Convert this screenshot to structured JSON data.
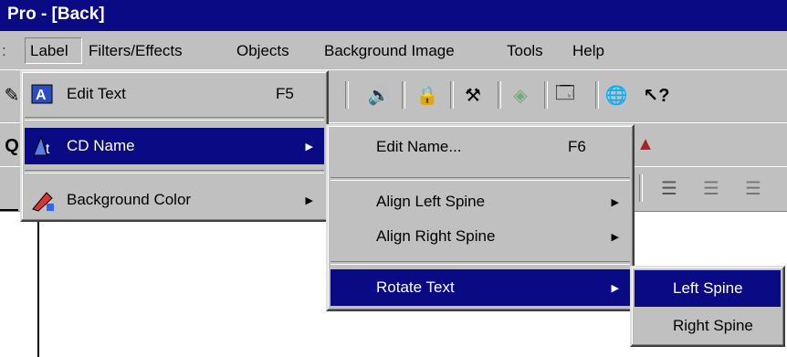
{
  "window": {
    "title": "Pro - [Back]"
  },
  "menubar": {
    "items": [
      {
        "label": "Label"
      },
      {
        "label": "Filters/Effects"
      },
      {
        "label": "Objects"
      },
      {
        "label": "Background Image"
      },
      {
        "label": "Tools"
      },
      {
        "label": "Help"
      }
    ]
  },
  "label_menu": {
    "items": [
      {
        "label": "Edit Text",
        "shortcut": "F5",
        "icon": "edit-text-icon"
      },
      {
        "label": "CD Name",
        "icon": "cd-name-icon",
        "submenu": true
      },
      {
        "label": "Background Color",
        "icon": "paint-bucket-icon",
        "submenu": true
      }
    ]
  },
  "cdname_menu": {
    "items": [
      {
        "label": "Edit Name...",
        "shortcut": "F6"
      },
      {
        "label": "Align Left Spine",
        "submenu": true
      },
      {
        "label": "Align Right Spine",
        "submenu": true
      },
      {
        "label": "Rotate Text",
        "submenu": true
      }
    ]
  },
  "rotate_menu": {
    "items": [
      {
        "label": "Left Spine"
      },
      {
        "label": "Right Spine"
      }
    ]
  },
  "arrow_glyph": "▶",
  "colors": {
    "title_bar": "#0a0a84",
    "menu_bg": "#c0c0c0",
    "highlight": "#0a0a84"
  }
}
